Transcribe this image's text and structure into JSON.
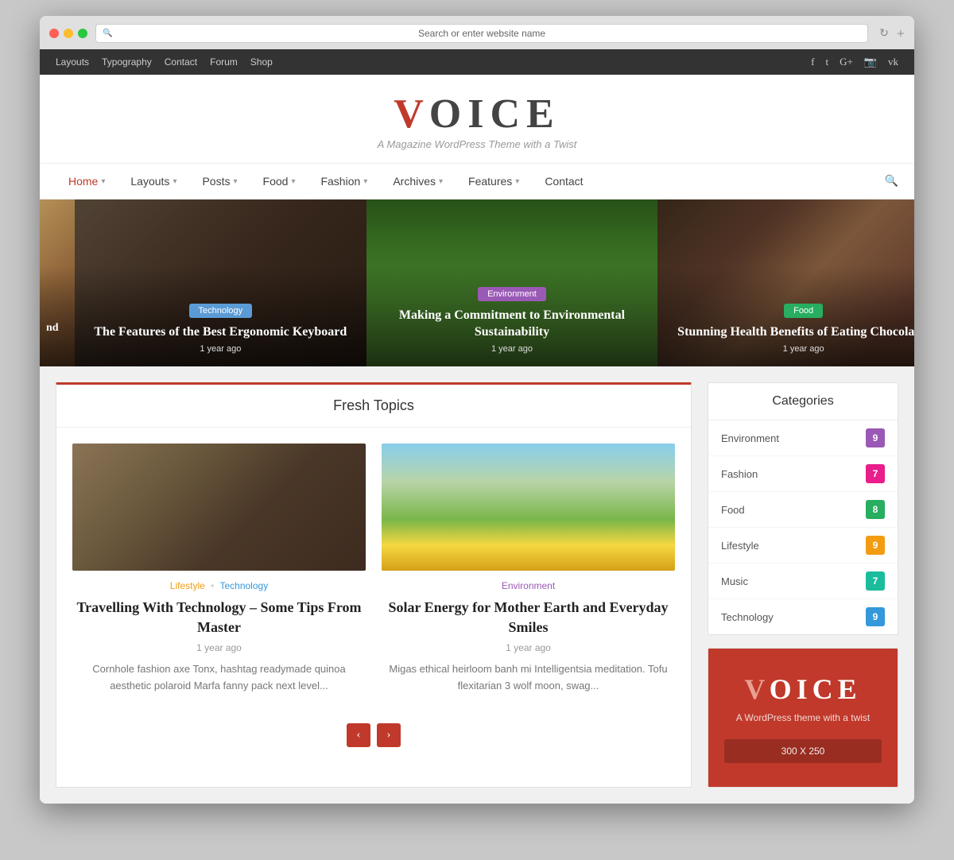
{
  "browser": {
    "address": "Search or enter website name",
    "plus": "+"
  },
  "topnav": {
    "links": [
      "Layouts",
      "Typography",
      "Contact",
      "Forum",
      "Shop"
    ],
    "social": [
      "f",
      "t",
      "G+",
      "📷",
      "vk"
    ]
  },
  "logo": {
    "v": "V",
    "rest": "OICE",
    "tagline": "A Magazine WordPress Theme with a Twist"
  },
  "mainnav": {
    "items": [
      {
        "label": "Home",
        "hasDropdown": true,
        "active": true
      },
      {
        "label": "Layouts",
        "hasDropdown": true,
        "active": false
      },
      {
        "label": "Posts",
        "hasDropdown": true,
        "active": false
      },
      {
        "label": "Food",
        "hasDropdown": true,
        "active": false
      },
      {
        "label": "Fashion",
        "hasDropdown": true,
        "active": false
      },
      {
        "label": "Archives",
        "hasDropdown": true,
        "active": false
      },
      {
        "label": "Features",
        "hasDropdown": true,
        "active": false
      },
      {
        "label": "Contact",
        "hasDropdown": false,
        "active": false
      }
    ]
  },
  "heroSlides": [
    {
      "badge": "Technology",
      "badgeClass": "badge-tech",
      "title": "The Features of the Best Ergonomic Keyboard",
      "time": "1 year ago"
    },
    {
      "badge": "Environment",
      "badgeClass": "badge-env",
      "title": "Making a Commitment to Environmental Sustainability",
      "time": "1 year ago"
    },
    {
      "badge": "Food",
      "badgeClass": "badge-food",
      "title": "Stunning Health Benefits of Eating Chocolates",
      "time": "1 year ago"
    }
  ],
  "freshTopics": {
    "title": "Fresh Topics",
    "articles": [
      {
        "meta1": "Lifestyle",
        "meta1Class": "meta-lifestyle",
        "meta2": "Technology",
        "meta2Class": "meta-technology",
        "title": "Travelling With Technology – Some Tips From Master",
        "time": "1 year ago",
        "excerpt": "Cornhole fashion axe Tonx, hashtag readymade quinoa aesthetic polaroid Marfa fanny pack next level...",
        "imgClass": "img-tech"
      },
      {
        "meta1": "Environment",
        "meta1Class": "meta-environment",
        "meta2": null,
        "title": "Solar Energy for Mother Earth and Everyday Smiles",
        "time": "1 year ago",
        "excerpt": "Migas ethical heirloom banh mi Intelligentsia meditation. Tofu flexitarian 3 wolf moon, swag...",
        "imgClass": "img-nature"
      }
    ],
    "prevBtn": "‹",
    "nextBtn": "›"
  },
  "sidebar": {
    "categories": {
      "title": "Categories",
      "items": [
        {
          "label": "Environment",
          "count": "9",
          "countClass": "count-purple"
        },
        {
          "label": "Fashion",
          "count": "7",
          "countClass": "count-pink"
        },
        {
          "label": "Food",
          "count": "8",
          "countClass": "count-green"
        },
        {
          "label": "Lifestyle",
          "count": "9",
          "countClass": "count-orange"
        },
        {
          "label": "Music",
          "count": "7",
          "countClass": "count-teal"
        },
        {
          "label": "Technology",
          "count": "9",
          "countClass": "count-blue"
        }
      ]
    },
    "ad": {
      "v": "V",
      "rest": "OICE",
      "tagline": "A WordPress theme with a twist",
      "size": "300 X 250"
    }
  }
}
